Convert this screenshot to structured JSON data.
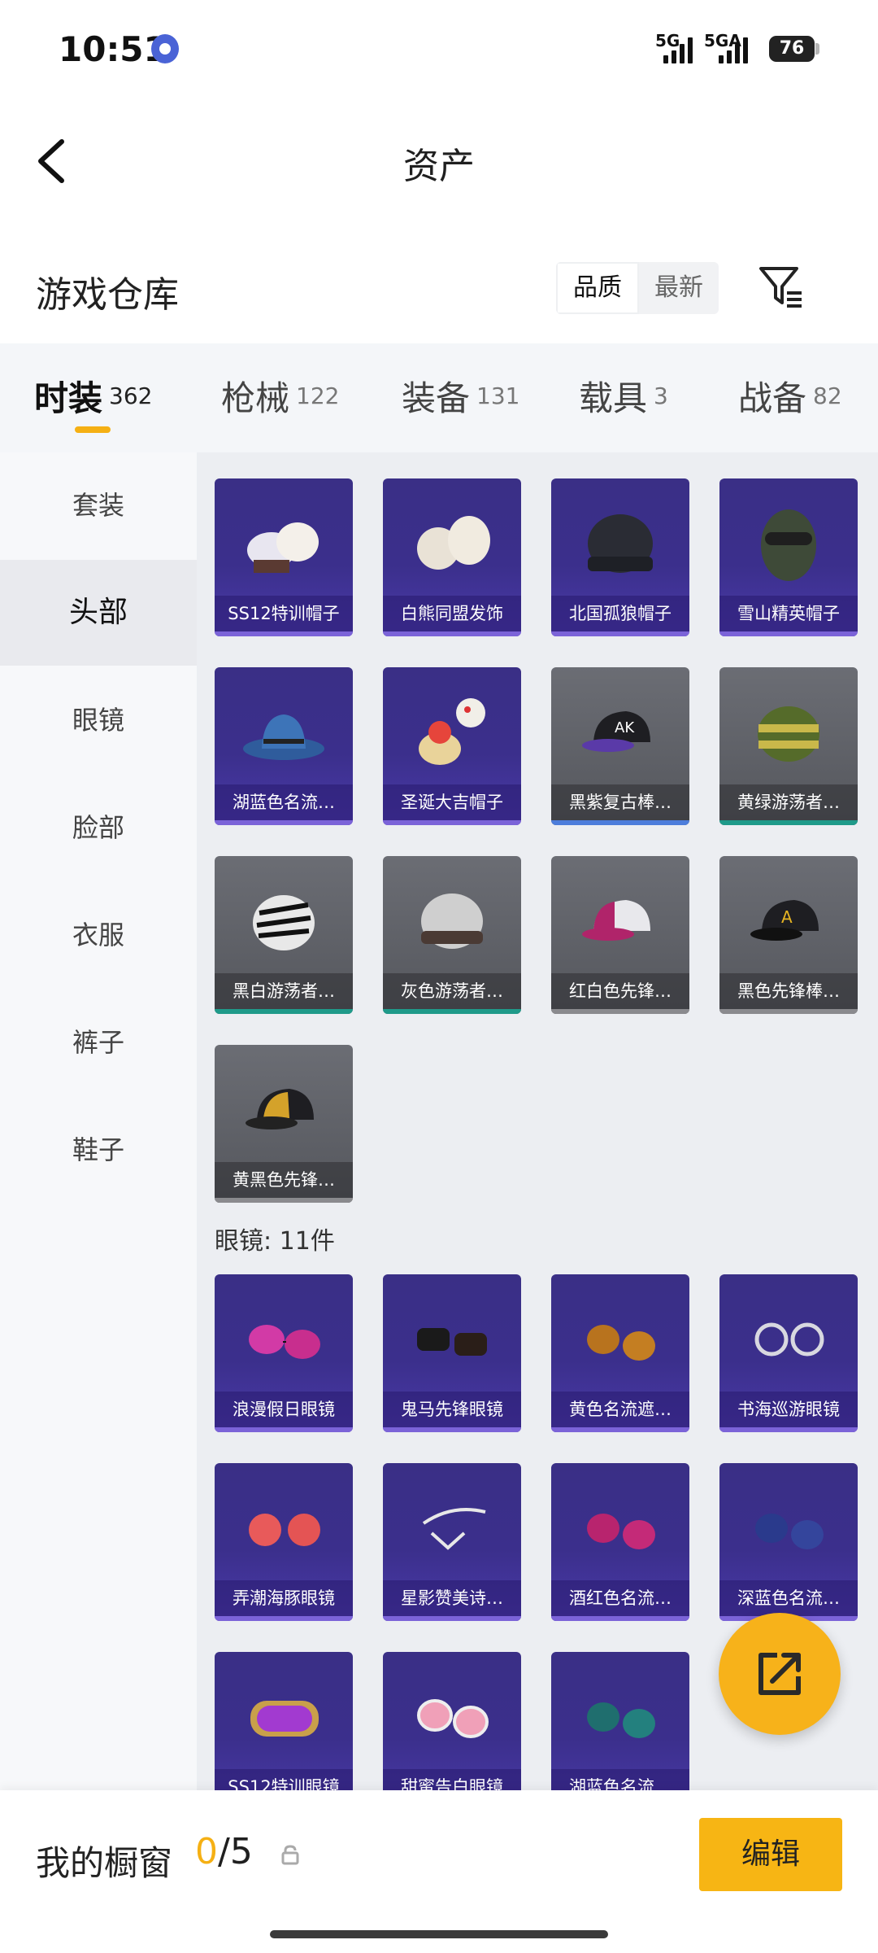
{
  "status_bar": {
    "time": "10:51",
    "signal1": "5G",
    "signal2": "5GA",
    "battery": "76"
  },
  "header": {
    "title": "资产"
  },
  "section": {
    "title": "游戏仓库",
    "sort_options": [
      "品质",
      "最新"
    ],
    "sort_selected": "品质"
  },
  "tabs": [
    {
      "label": "时装",
      "count": "362"
    },
    {
      "label": "枪械",
      "count": "122"
    },
    {
      "label": "装备",
      "count": "131"
    },
    {
      "label": "载具",
      "count": "3"
    },
    {
      "label": "战备",
      "count": "82"
    }
  ],
  "sidebar": {
    "items": [
      "套装",
      "头部",
      "眼镜",
      "脸部",
      "衣服",
      "裤子",
      "鞋子"
    ],
    "selected": "头部"
  },
  "head_items": [
    {
      "name": "SS12特训帽子",
      "tier": "purple"
    },
    {
      "name": "白熊同盟发饰",
      "tier": "purple"
    },
    {
      "name": "北国孤狼帽子",
      "tier": "purple"
    },
    {
      "name": "雪山精英帽子",
      "tier": "purple"
    },
    {
      "name": "湖蓝色名流…",
      "tier": "purple"
    },
    {
      "name": "圣诞大吉帽子",
      "tier": "purple"
    },
    {
      "name": "黑紫复古棒…",
      "tier": "grey-blue"
    },
    {
      "name": "黄绿游荡者…",
      "tier": "grey-teal"
    },
    {
      "name": "黑白游荡者…",
      "tier": "grey-teal"
    },
    {
      "name": "灰色游荡者…",
      "tier": "grey-teal"
    },
    {
      "name": "红白色先锋…",
      "tier": "grey"
    },
    {
      "name": "黑色先锋棒…",
      "tier": "grey"
    },
    {
      "name": "黄黑色先锋…",
      "tier": "grey"
    }
  ],
  "glasses_group": {
    "label": "眼镜: 11件",
    "items": [
      {
        "name": "浪漫假日眼镜"
      },
      {
        "name": "鬼马先锋眼镜"
      },
      {
        "name": "黄色名流遮…"
      },
      {
        "name": "书海巡游眼镜"
      },
      {
        "name": "弄潮海豚眼镜"
      },
      {
        "name": "星影赞美诗…"
      },
      {
        "name": "酒红色名流…"
      },
      {
        "name": "深蓝色名流…"
      },
      {
        "name": "SS12特训眼镜"
      },
      {
        "name": "甜蜜告白眼镜"
      },
      {
        "name": "湖蓝色名流…"
      }
    ]
  },
  "bottom_bar": {
    "label": "我的橱窗",
    "current": "0",
    "total": "/5",
    "edit_label": "编辑"
  },
  "colors": {
    "accent": "#f5b014",
    "purple_card": "#3b2f8c",
    "grey_card": "#5a5c62"
  },
  "icons": [
    "back-arrow-icon",
    "filter-icon",
    "share-export-icon",
    "lock-icon"
  ]
}
